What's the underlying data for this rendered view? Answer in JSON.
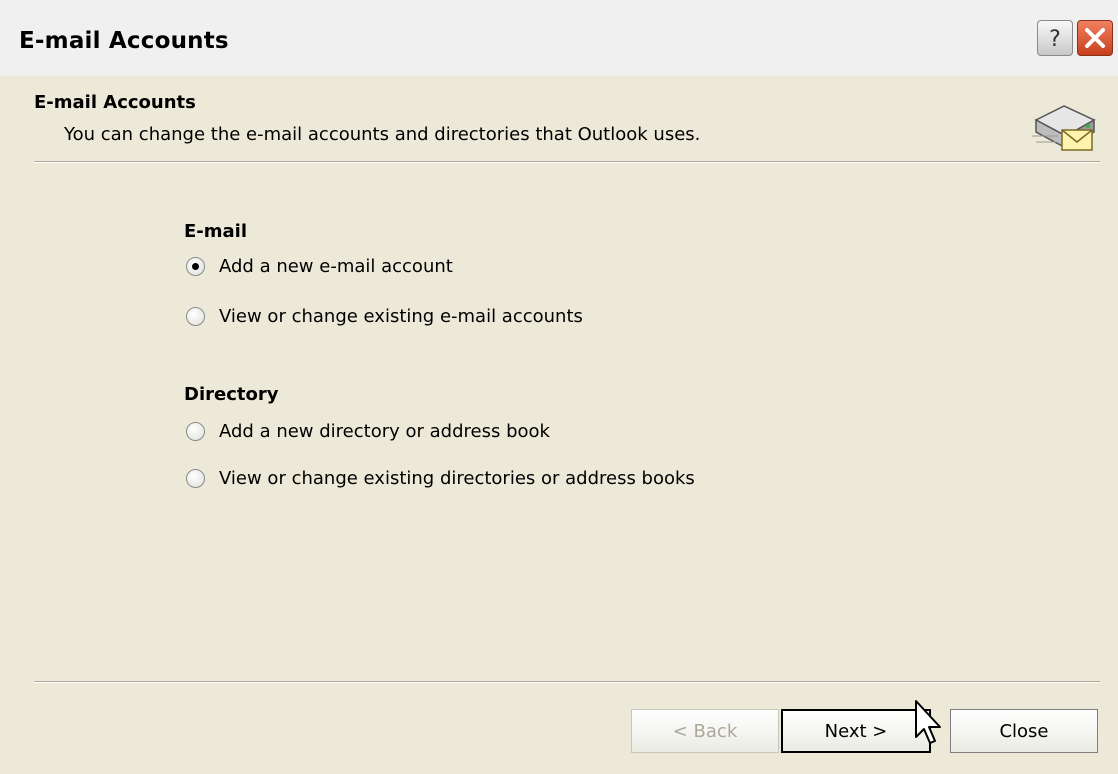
{
  "window": {
    "title": "E-mail Accounts",
    "help_label": "?",
    "close_label": "✕"
  },
  "header": {
    "title": "E-mail Accounts",
    "subtitle": "You can change the e-mail accounts and directories that Outlook uses.",
    "icon": "mail-server-icon"
  },
  "groups": {
    "email": {
      "label": "E-mail",
      "options": [
        {
          "label": "Add a new e-mail account",
          "checked": true
        },
        {
          "label": "View or change existing e-mail accounts",
          "checked": false
        }
      ]
    },
    "directory": {
      "label": "Directory",
      "options": [
        {
          "label": "Add a new directory or address book",
          "checked": false
        },
        {
          "label": "View or change existing directories or address books",
          "checked": false
        }
      ]
    }
  },
  "buttons": {
    "back": "< Back",
    "next": "Next >",
    "close": "Close"
  },
  "colors": {
    "dialog_bg": "#ece9d8",
    "close_button_red": "#c8401c",
    "disabled_text": "#aca899"
  }
}
